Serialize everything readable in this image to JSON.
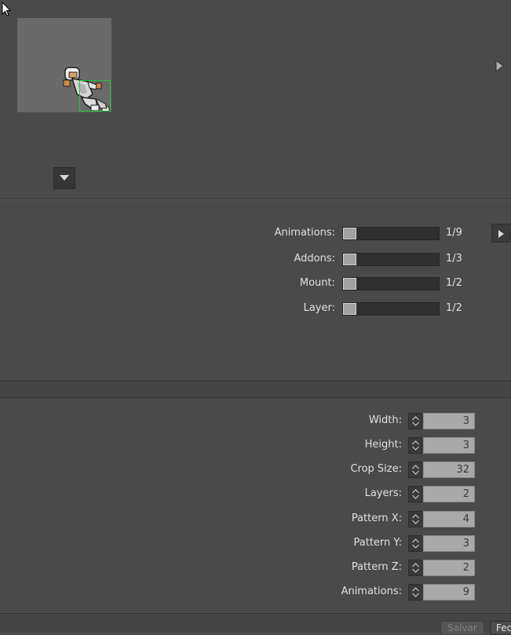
{
  "preview": {
    "sprite": "white-armored-character-sprite",
    "icons": {
      "cursor": "mouse-cursor-icon",
      "next": "triangle-right-icon",
      "dropdown": "triangle-down-icon",
      "play": "play-icon"
    }
  },
  "sliders": [
    {
      "label": "Animations:",
      "value": "1/9",
      "fraction": 0
    },
    {
      "label": "Addons:",
      "value": "1/3",
      "fraction": 0
    },
    {
      "label": "Mount:",
      "value": "1/2",
      "fraction": 0
    },
    {
      "label": "Layer:",
      "value": "1/2",
      "fraction": 0
    }
  ],
  "properties": [
    {
      "label": "Width:",
      "value": "3"
    },
    {
      "label": "Height:",
      "value": "3"
    },
    {
      "label": "Crop Size:",
      "value": "32"
    },
    {
      "label": "Layers:",
      "value": "2"
    },
    {
      "label": "Pattern X:",
      "value": "4"
    },
    {
      "label": "Pattern Y:",
      "value": "3"
    },
    {
      "label": "Pattern Z:",
      "value": "2"
    },
    {
      "label": "Animations:",
      "value": "9"
    }
  ],
  "footer": {
    "save_label": "Salvar",
    "close_label": "Fechar"
  },
  "colors": {
    "background": "#4a4a4a",
    "selection": "#22c33a",
    "preview_bg": "#6a6a6a"
  }
}
